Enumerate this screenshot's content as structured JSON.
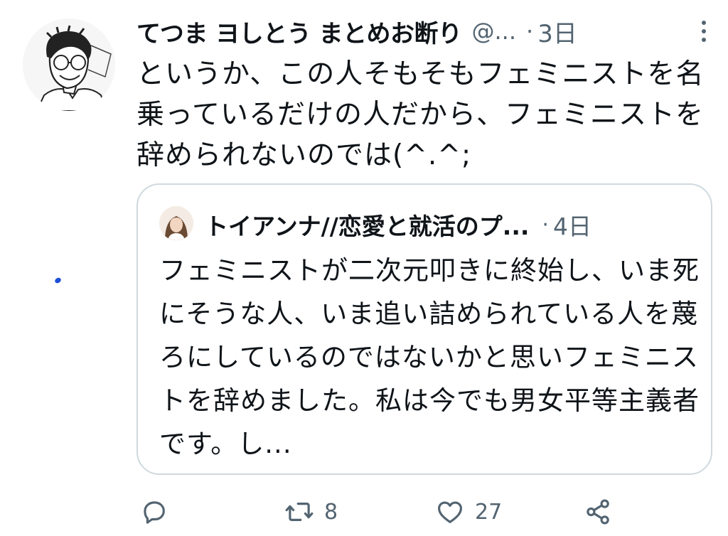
{
  "author": {
    "display_name": "てつま ヨしとう まとめお断り",
    "handle": "@...",
    "separator": "·",
    "time": "3日"
  },
  "tweet": {
    "text": "というか、この人そもそもフェミニストを名乗っているだけの人だから、フェミニストを辞められないのでは(^.^;"
  },
  "quoted": {
    "display_name": "トイアンナ//恋愛と就活のプ...",
    "separator": "·",
    "time": "4日",
    "text": "フェミニストが二次元叩きに終始し、いま死にそうな人、いま追い詰められている人を蔑ろにしているのではないかと思いフェミニストを辞めました。私は今でも男女平等主義者です。し..."
  },
  "actions": {
    "reply_count": "",
    "retweet_count": "8",
    "like_count": "27"
  },
  "icons": {
    "more": "more-vertical-icon",
    "reply": "reply-icon",
    "retweet": "retweet-icon",
    "like": "heart-icon",
    "share": "share-icon"
  },
  "colors": {
    "text": "#0f1419",
    "secondary": "#536471",
    "border": "#cfd9de"
  }
}
